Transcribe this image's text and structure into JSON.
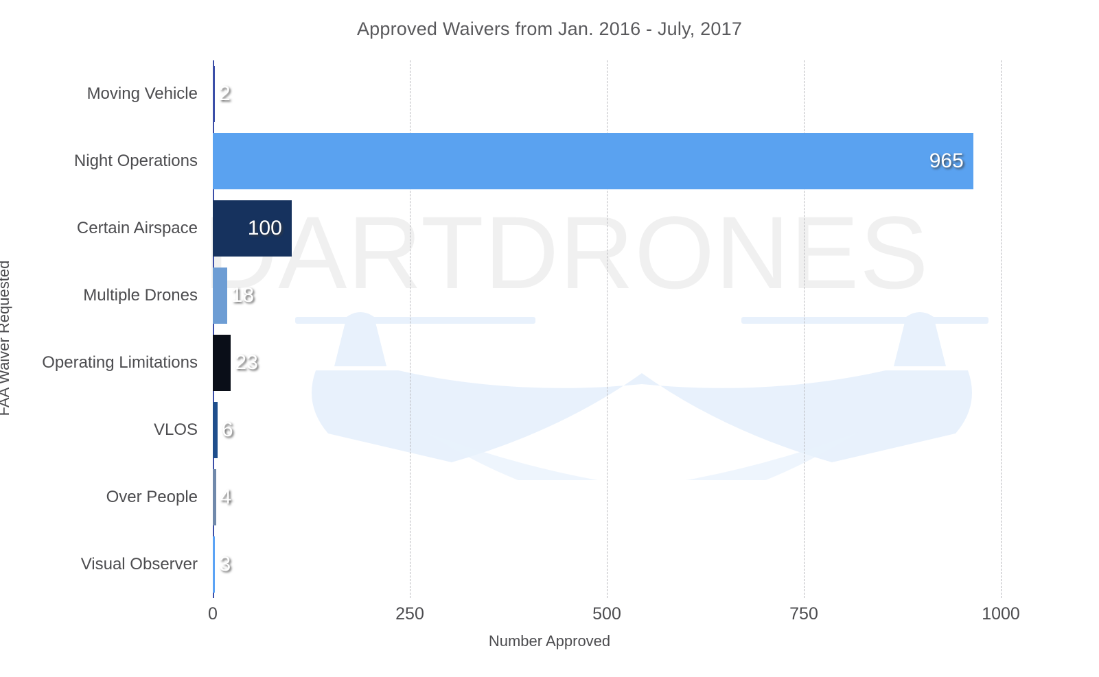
{
  "chart_data": {
    "type": "bar",
    "orientation": "horizontal",
    "title": "Approved Waivers from Jan. 2016 - July, 2017",
    "xlabel": "Number Approved",
    "ylabel": "FAA Waiver  Requested",
    "xlim": [
      0,
      1000
    ],
    "xticks": [
      0,
      250,
      500,
      750,
      1000
    ],
    "xtick_labels": [
      "0",
      "250",
      "500",
      "750",
      "1000"
    ],
    "grid": "vertical-dashed",
    "legend": "none",
    "categories": [
      "Moving Vehicle",
      "Night Operations",
      "Certain Airspace",
      "Multiple Drones",
      "Operating Limitations",
      "VLOS",
      "Over People",
      "Visual Observer"
    ],
    "values": [
      2,
      965,
      100,
      18,
      23,
      6,
      4,
      3
    ],
    "value_labels": [
      "2",
      "965",
      "100",
      "18",
      "23",
      "6",
      "4",
      "3"
    ],
    "bar_colors": [
      "#3b4ea8",
      "#5aa2f0",
      "#16325e",
      "#6d9dd4",
      "#0a0e18",
      "#1f4e8c",
      "#7089ab",
      "#5ba3f5"
    ]
  },
  "watermark": {
    "brand_text": "DARTDRONES",
    "brand_text_color": "#f0f0f0",
    "drone_color": "#e8f1fc",
    "drone_icon": "drone-silhouette"
  },
  "style": {
    "background": "#ffffff",
    "axis_color": "#3b4ea8",
    "gridline_color": "#b9b9bd",
    "title_color": "#59595c",
    "label_color": "#4c4c4f",
    "value_label_color": "#ffffff"
  }
}
